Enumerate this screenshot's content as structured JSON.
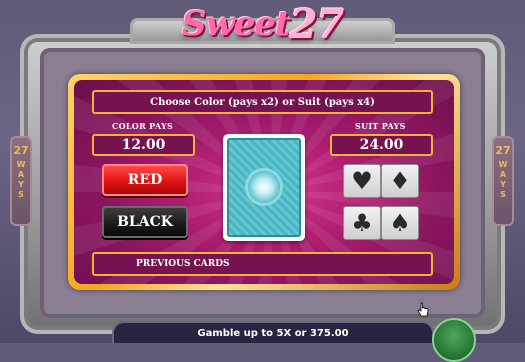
{
  "logo": {
    "word": "Sweet",
    "number": "27"
  },
  "side_left": {
    "number": "27",
    "label": "WAYS"
  },
  "side_right": {
    "number": "27",
    "label": "WAYS"
  },
  "gamble": {
    "title": "Choose Color (pays x2) or Suit (pays x4)",
    "color_pays_label": "COLOR PAYS",
    "color_pays_value": "12.00",
    "suit_pays_label": "SUIT PAYS",
    "suit_pays_value": "24.00",
    "red_label": "RED",
    "black_label": "BLACK",
    "suits": {
      "heart": "♥",
      "diamond": "♦",
      "club": "♣",
      "spade": "♠"
    },
    "previous_cards_label": "PREVIOUS CARDS"
  },
  "status": {
    "text": "Gamble up to 5X or 375.00"
  },
  "colors": {
    "panel": "#b31f74",
    "gold": "#f2b13a",
    "red_button": "#e01212",
    "black_button": "#1c1c1c",
    "card_teal": "#4bb5c3"
  }
}
